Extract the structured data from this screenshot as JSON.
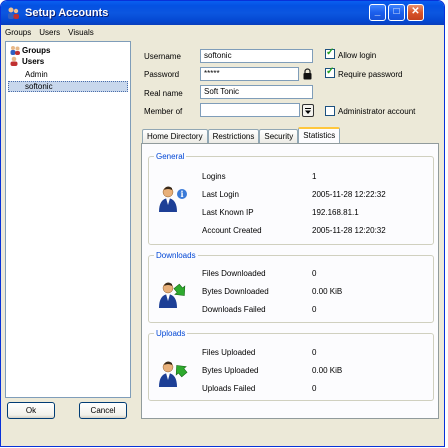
{
  "window": {
    "title": "Setup Accounts",
    "min": "_",
    "max": "□",
    "close": "✕"
  },
  "menu": [
    "Groups",
    "Users",
    "Visuals"
  ],
  "tree": {
    "groups": "Groups",
    "users": "Users",
    "admin": "Admin",
    "softonic": "softonic"
  },
  "buttons": {
    "ok": "Ok",
    "cancel": "Cancel"
  },
  "form": {
    "username_label": "Username",
    "username": "softonic",
    "password_label": "Password",
    "password": "*****",
    "realname_label": "Real name",
    "realname": "Soft Tonic",
    "memberof_label": "Member of",
    "memberof": "",
    "allow_login": "Allow login",
    "require_password": "Require password",
    "administrator": "Administrator account"
  },
  "tabs": [
    "Home Directory",
    "Restrictions",
    "Security",
    "Statistics"
  ],
  "general": {
    "title": "General",
    "rows": [
      {
        "label": "Logins",
        "value": "1"
      },
      {
        "label": "Last Login",
        "value": "2005-11-28 12:22:32"
      },
      {
        "label": "Last Known IP",
        "value": "192.168.81.1"
      },
      {
        "label": "Account Created",
        "value": "2005-11-28 12:20:32"
      }
    ]
  },
  "downloads": {
    "title": "Downloads",
    "rows": [
      {
        "label": "Files Downloaded",
        "value": "0"
      },
      {
        "label": "Bytes Downloaded",
        "value": "0.00 KiB"
      },
      {
        "label": "Downloads Failed",
        "value": "0"
      }
    ]
  },
  "uploads": {
    "title": "Uploads",
    "rows": [
      {
        "label": "Files Uploaded",
        "value": "0"
      },
      {
        "label": "Bytes Uploaded",
        "value": "0.00 KiB"
      },
      {
        "label": "Uploads Failed",
        "value": "0"
      }
    ]
  }
}
